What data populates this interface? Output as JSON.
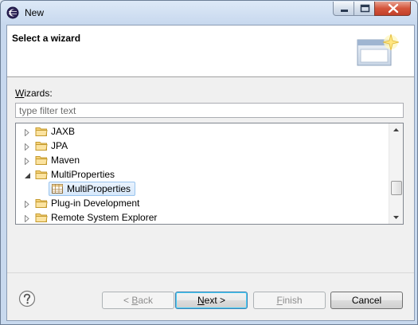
{
  "window": {
    "title": "New"
  },
  "banner": {
    "title": "Select a wizard"
  },
  "wizards": {
    "label_mnemonic": "W",
    "label_rest": "izards:",
    "filter_placeholder": "type filter text"
  },
  "tree": {
    "items": [
      {
        "label": "JAXB",
        "level": 0,
        "expanded": false,
        "icon": "folder-icon"
      },
      {
        "label": "JPA",
        "level": 0,
        "expanded": false,
        "icon": "folder-icon"
      },
      {
        "label": "Maven",
        "level": 0,
        "expanded": false,
        "icon": "folder-icon"
      },
      {
        "label": "MultiProperties",
        "level": 0,
        "expanded": true,
        "icon": "folder-icon"
      },
      {
        "label": "MultiProperties",
        "level": 1,
        "selected": true,
        "icon": "table-icon"
      },
      {
        "label": "Plug-in Development",
        "level": 0,
        "expanded": false,
        "icon": "folder-icon"
      },
      {
        "label": "Remote System Explorer",
        "level": 0,
        "expanded": false,
        "icon": "folder-icon"
      }
    ]
  },
  "buttons": {
    "back": {
      "mnemonic": "B",
      "pre": "< ",
      "post": "ack"
    },
    "next": {
      "mnemonic": "N",
      "pre": "",
      "post": "ext >"
    },
    "finish": {
      "mnemonic": "F",
      "pre": "",
      "post": "inish"
    },
    "cancel": {
      "label": "Cancel"
    }
  },
  "colors": {
    "selection": "#d6e8fb",
    "default_button_border": "#3c7fb1"
  }
}
